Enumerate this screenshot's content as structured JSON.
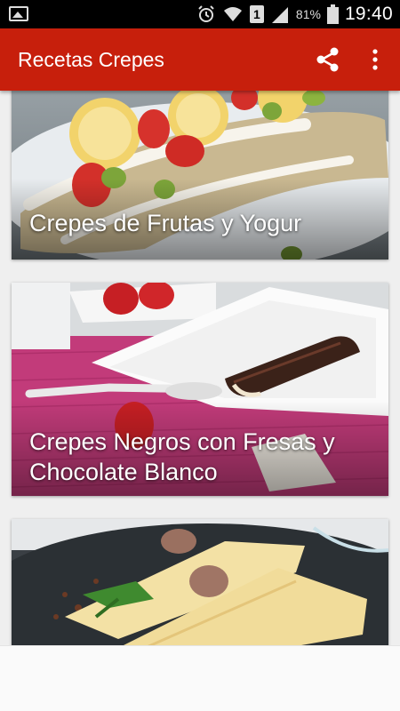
{
  "status_bar": {
    "battery_percent": "81%",
    "time": "19:40",
    "sim_slot": "1",
    "icons": [
      "gallery-icon",
      "alarm-icon",
      "wifi-icon",
      "sim-icon",
      "signal-icon",
      "battery-icon"
    ]
  },
  "app_bar": {
    "title": "Recetas Crepes",
    "background_color": "#c71f0c",
    "icons": [
      "share-icon",
      "more-vert-icon"
    ]
  },
  "recipes": [
    {
      "title": "Crepes de Frutas y Yogur"
    },
    {
      "title": "Crepes Negros con Fresas y Chocolate Blanco"
    },
    {
      "title": ""
    }
  ]
}
